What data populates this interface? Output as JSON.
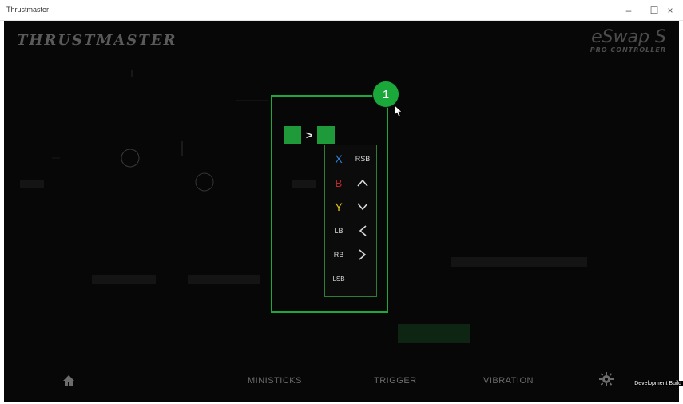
{
  "window": {
    "title": "Thrustmaster",
    "minimize_glyph": "–",
    "maximize_glyph": "☐",
    "close_glyph": "×"
  },
  "header": {
    "brand_left": "THRUSTMASTER",
    "brand_right_main": "eSwap S",
    "brand_right_sub": "PRO CONTROLLER"
  },
  "callout": {
    "number": "1"
  },
  "mapping": {
    "separator": ">"
  },
  "dropdown": {
    "items": [
      {
        "left": "X",
        "left_color": "#2f7fd8",
        "right": "RSB",
        "right_icon": ""
      },
      {
        "left": "B",
        "left_color": "#c0262b",
        "right": "",
        "right_icon": "chevron-up-icon"
      },
      {
        "left": "Y",
        "left_color": "#e0c31a",
        "right": "",
        "right_icon": "chevron-down-icon"
      },
      {
        "left": "LB",
        "left_color": "#d9d9d9",
        "right": "",
        "right_icon": "chevron-left-icon"
      },
      {
        "left": "RB",
        "left_color": "#d9d9d9",
        "right": "",
        "right_icon": "chevron-right-icon"
      },
      {
        "left": "LSB",
        "left_color": "#d9d9d9",
        "right": "",
        "right_icon": ""
      }
    ]
  },
  "nav": {
    "ministicks": "MINISTICKS",
    "trigger": "TRIGGER",
    "vibration": "VIBRATION"
  },
  "footer": {
    "dev_label": "Development Build"
  },
  "colors": {
    "accent_green": "#1ea83b",
    "background": "#070707",
    "nav_text": "#6c6c6c"
  }
}
